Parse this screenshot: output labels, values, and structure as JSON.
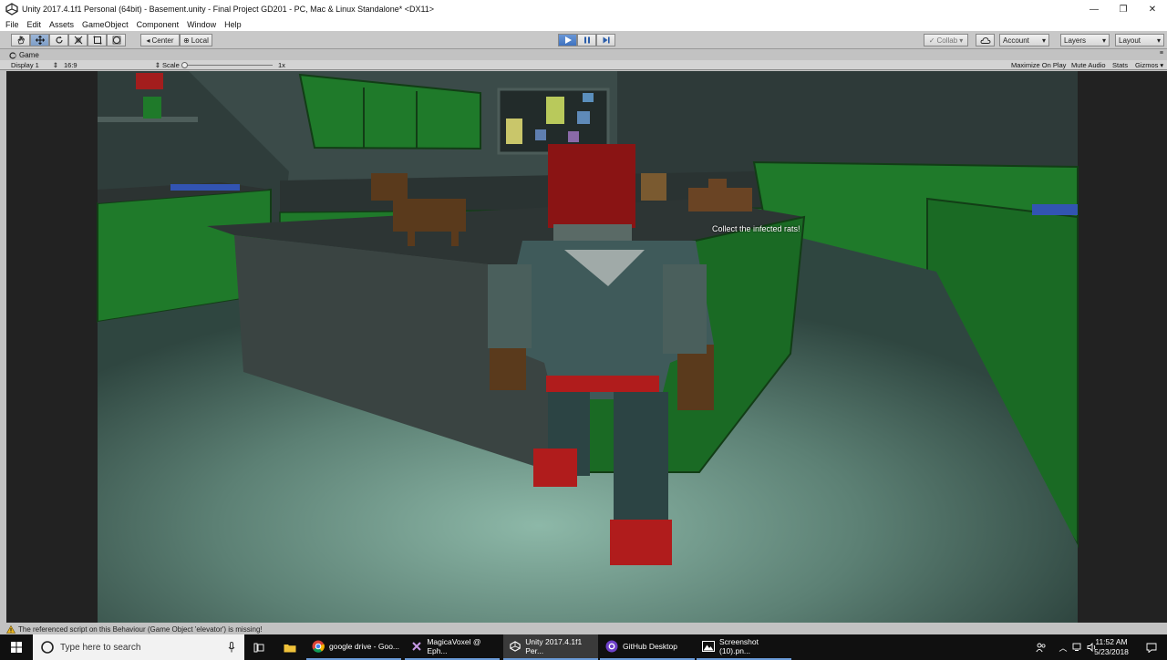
{
  "window": {
    "title": "Unity 2017.4.1f1 Personal (64bit) - Basement.unity - Final Project GD201 - PC, Mac & Linux Standalone* <DX11>",
    "controls": {
      "minimize": "—",
      "restore": "❐",
      "close": "✕"
    }
  },
  "menu": [
    "File",
    "Edit",
    "Assets",
    "GameObject",
    "Component",
    "Window",
    "Help"
  ],
  "toolbar": {
    "pivot_label": "Center",
    "space_label": "Local",
    "collab_label": "Collab",
    "account_label": "Account",
    "layers_label": "Layers",
    "layout_label": "Layout"
  },
  "game_panel": {
    "tab_label": "Game",
    "display_label": "Display 1",
    "aspect_label": "16:9",
    "scale_label": "Scale",
    "scale_value": "1x",
    "maximize_label": "Maximize On Play",
    "mute_label": "Mute Audio",
    "stats_label": "Stats",
    "gizmos_label": "Gizmos"
  },
  "game": {
    "objective_text": "Collect the infected rats!"
  },
  "console": {
    "message": "The referenced script on this Behaviour (Game Object 'elevator') is missing!"
  },
  "taskbar": {
    "search_placeholder": "Type here to search",
    "apps": [
      {
        "label": "google drive - Goo...",
        "icon": "chrome-icon"
      },
      {
        "label": "MagicaVoxel @ Eph...",
        "icon": "magicavoxel-icon"
      },
      {
        "label": "Unity 2017.4.1f1 Per...",
        "icon": "unity-icon"
      },
      {
        "label": "GitHub Desktop",
        "icon": "github-icon"
      },
      {
        "label": "Screenshot (10).pn...",
        "icon": "photos-icon"
      }
    ],
    "time": "11:52 AM",
    "date": "5/23/2018"
  },
  "colors": {
    "play_active": "#3e72c0",
    "taskbar_bg": "#101010",
    "cabinet_green": "#1f7a2a",
    "hair_red": "#8a1414"
  }
}
